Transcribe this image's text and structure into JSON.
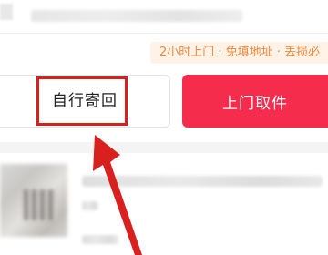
{
  "promo": {
    "text": "2小时上门 · 免填地址 · 丢损必"
  },
  "actions": {
    "self_return_label": "自行寄回",
    "pickup_label": "上门取件"
  },
  "colors": {
    "pickup_button": "#f52c4c",
    "promo_text": "#f2883b",
    "promo_bg": "#fff3e8",
    "annotation_red": "#d8201e"
  },
  "icons": {
    "annotation_arrow": "red-arrow-icon"
  }
}
